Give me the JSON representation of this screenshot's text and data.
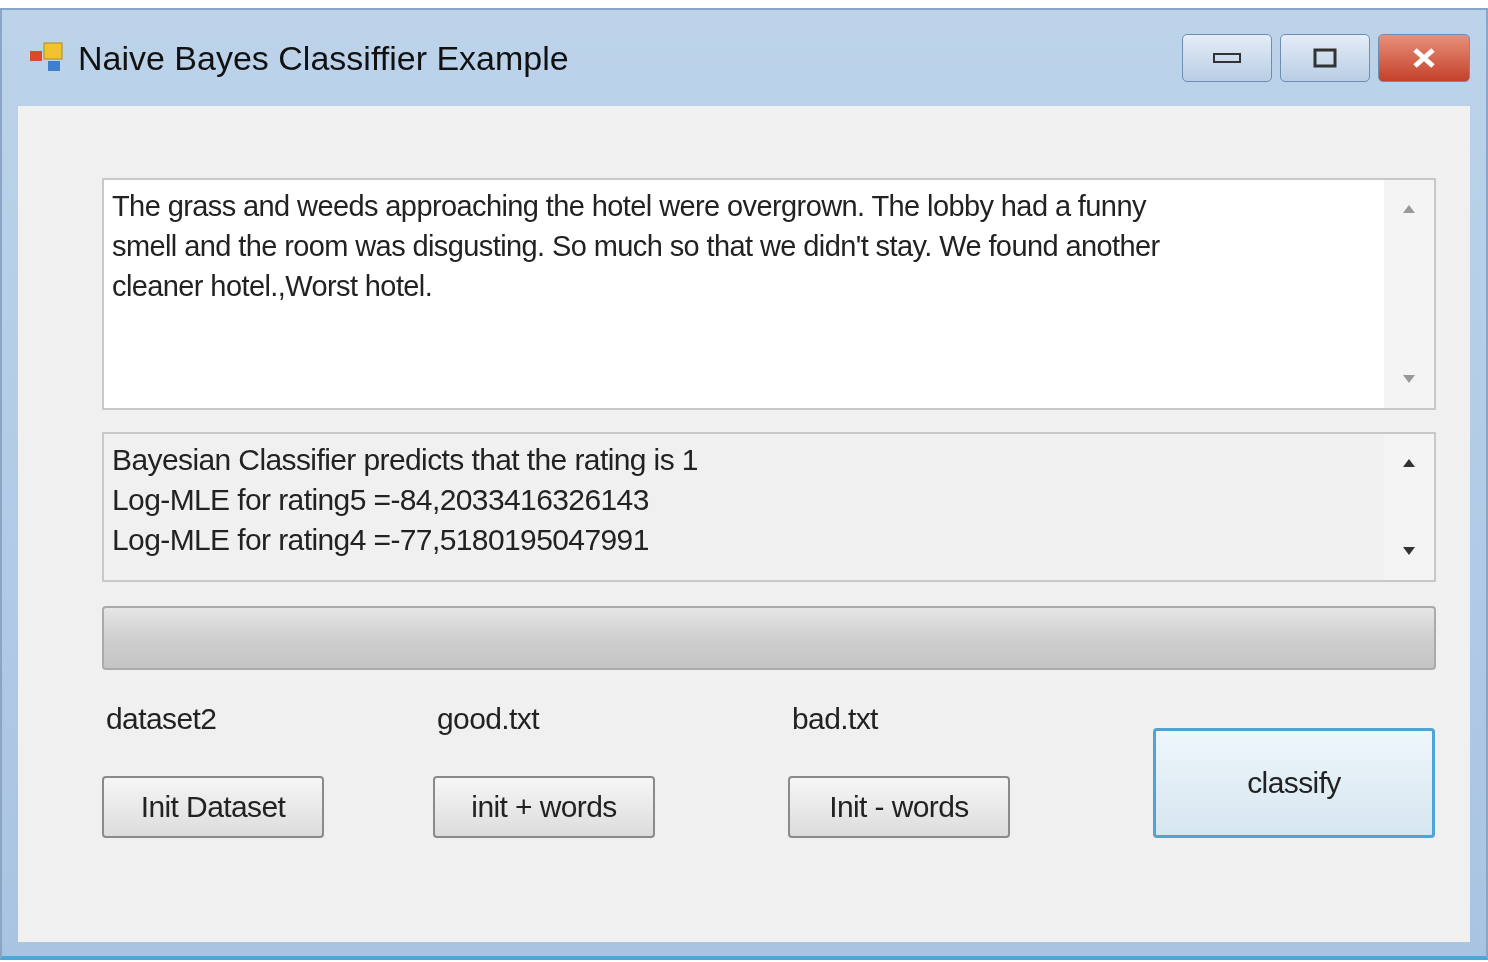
{
  "window": {
    "title": "Naive Bayes Classiffier Example"
  },
  "input_text": {
    "value": "The grass and weeds approaching the hotel were overgrown. The lobby had a funny smell and the room was disgusting. So much so that we didn't stay. We found another cleaner hotel.,Worst hotel."
  },
  "output_lines": [
    "Bayesian Classifier predicts that the rating is 1",
    "Log-MLE for rating5 =-84,2033416326143",
    "Log-MLE for rating4 =-77,5180195047991"
  ],
  "progress": {
    "level": 0
  },
  "columns": [
    {
      "label": "dataset2",
      "button": "Init Dataset"
    },
    {
      "label": "good.txt",
      "button": "init + words"
    },
    {
      "label": "bad.txt",
      "button": "Init - words"
    }
  ],
  "classify_button": {
    "label": "classify",
    "focused": true
  }
}
